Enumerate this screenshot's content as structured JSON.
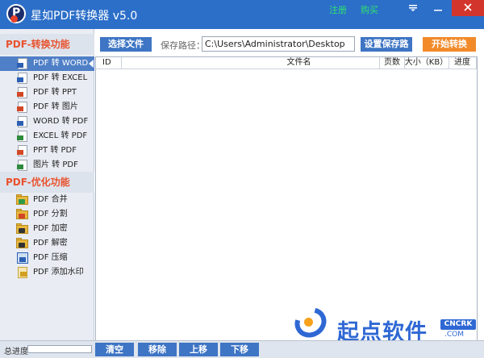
{
  "titlebar": {
    "title": "星如PDF转换器 v5.0",
    "register_link": "注册",
    "buy_link": "购买",
    "menu_icon": "hamburger-icon",
    "minimize_icon": "minimize-icon",
    "close_icon": "close-icon"
  },
  "sidebar": {
    "convert_heading": "PDF-转换功能",
    "convert_items": [
      {
        "label": "PDF 转 WORD",
        "icon": "word-file-icon",
        "color": "#2b5fb3"
      },
      {
        "label": "PDF 转 EXCEL",
        "icon": "excel-file-icon",
        "color": "#2b5fb3"
      },
      {
        "label": "PDF 转 PPT",
        "icon": "ppt-file-icon",
        "color": "#d24726"
      },
      {
        "label": "PDF 转 图片",
        "icon": "image-file-icon",
        "color": "#d24726"
      },
      {
        "label": "WORD 转 PDF",
        "icon": "word-to-pdf-icon",
        "color": "#2b5fb3"
      },
      {
        "label": "EXCEL 转 PDF",
        "icon": "excel-to-pdf-icon",
        "color": "#2e8b3e"
      },
      {
        "label": "PPT 转 PDF",
        "icon": "ppt-to-pdf-icon",
        "color": "#d24726"
      },
      {
        "label": "图片 转 PDF",
        "icon": "image-to-pdf-icon",
        "color": "#2e8b3e"
      }
    ],
    "optimize_heading": "PDF-优化功能",
    "optimize_items": [
      {
        "label": "PDF 合并",
        "icon": "merge-folder-icon",
        "color": "#2e9b4a"
      },
      {
        "label": "PDF 分割",
        "icon": "split-folder-icon",
        "color": "#d24726"
      },
      {
        "label": "PDF 加密",
        "icon": "lock-folder-icon",
        "color": "#333333"
      },
      {
        "label": "PDF 解密",
        "icon": "unlock-folder-icon",
        "color": "#333333"
      },
      {
        "label": "PDF 压缩",
        "icon": "compress-icon",
        "color": "#2b5fb3"
      },
      {
        "label": "PDF 添加水印",
        "icon": "watermark-icon",
        "color": "#d2a020"
      }
    ]
  },
  "toolbar": {
    "select_file": "选择文件",
    "path_label": "保存路径：",
    "path_value": "C:\\Users\\Administrator\\Desktop",
    "set_path": "设置保存路径",
    "start": "开始转换"
  },
  "table": {
    "columns": [
      "ID",
      "文件名",
      "页数",
      "大小（KB）",
      "进度"
    ]
  },
  "footer": {
    "total_label": "总进度",
    "clear": "清空",
    "remove": "移除",
    "up": "上移",
    "down": "下移"
  },
  "watermark": {
    "brand": "起点软件",
    "badge": "CNCRK",
    "domain": ".COM"
  },
  "colors": {
    "titlebar": "#2c6fc9",
    "accent": "#3e75c4",
    "start": "#f28a2a",
    "section_heading": "#e8522e"
  }
}
